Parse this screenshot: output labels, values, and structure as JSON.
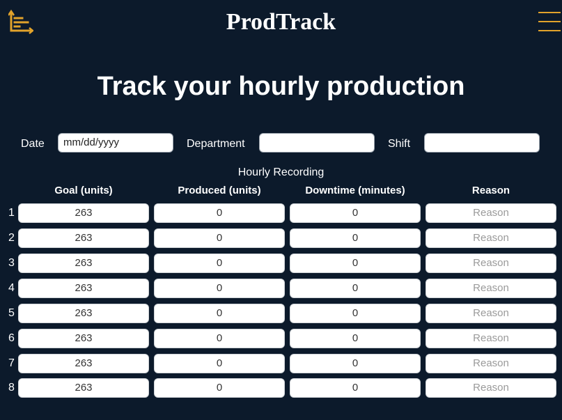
{
  "header": {
    "brand": "ProdTrack",
    "logo_icon": "chart-list-icon",
    "menu_icon": "hamburger-menu-icon",
    "accent_color": "#e2a32b"
  },
  "headline": "Track your hourly production",
  "form": {
    "date_label": "Date",
    "date_placeholder": "mm/dd/yyyy",
    "department_label": "Department",
    "department_value": "",
    "shift_label": "Shift",
    "shift_value": ""
  },
  "recording": {
    "title": "Hourly Recording",
    "columns": [
      "Goal (units)",
      "Produced (units)",
      "Downtime (minutes)",
      "Reason"
    ],
    "rows": [
      {
        "num": "1",
        "goal": "263",
        "produced": "0",
        "downtime": "0",
        "reason_placeholder": "Reason"
      },
      {
        "num": "2",
        "goal": "263",
        "produced": "0",
        "downtime": "0",
        "reason_placeholder": "Reason"
      },
      {
        "num": "3",
        "goal": "263",
        "produced": "0",
        "downtime": "0",
        "reason_placeholder": "Reason"
      },
      {
        "num": "4",
        "goal": "263",
        "produced": "0",
        "downtime": "0",
        "reason_placeholder": "Reason"
      },
      {
        "num": "5",
        "goal": "263",
        "produced": "0",
        "downtime": "0",
        "reason_placeholder": "Reason"
      },
      {
        "num": "6",
        "goal": "263",
        "produced": "0",
        "downtime": "0",
        "reason_placeholder": "Reason"
      },
      {
        "num": "7",
        "goal": "263",
        "produced": "0",
        "downtime": "0",
        "reason_placeholder": "Reason"
      },
      {
        "num": "8",
        "goal": "263",
        "produced": "0",
        "downtime": "0",
        "reason_placeholder": "Reason"
      }
    ]
  }
}
